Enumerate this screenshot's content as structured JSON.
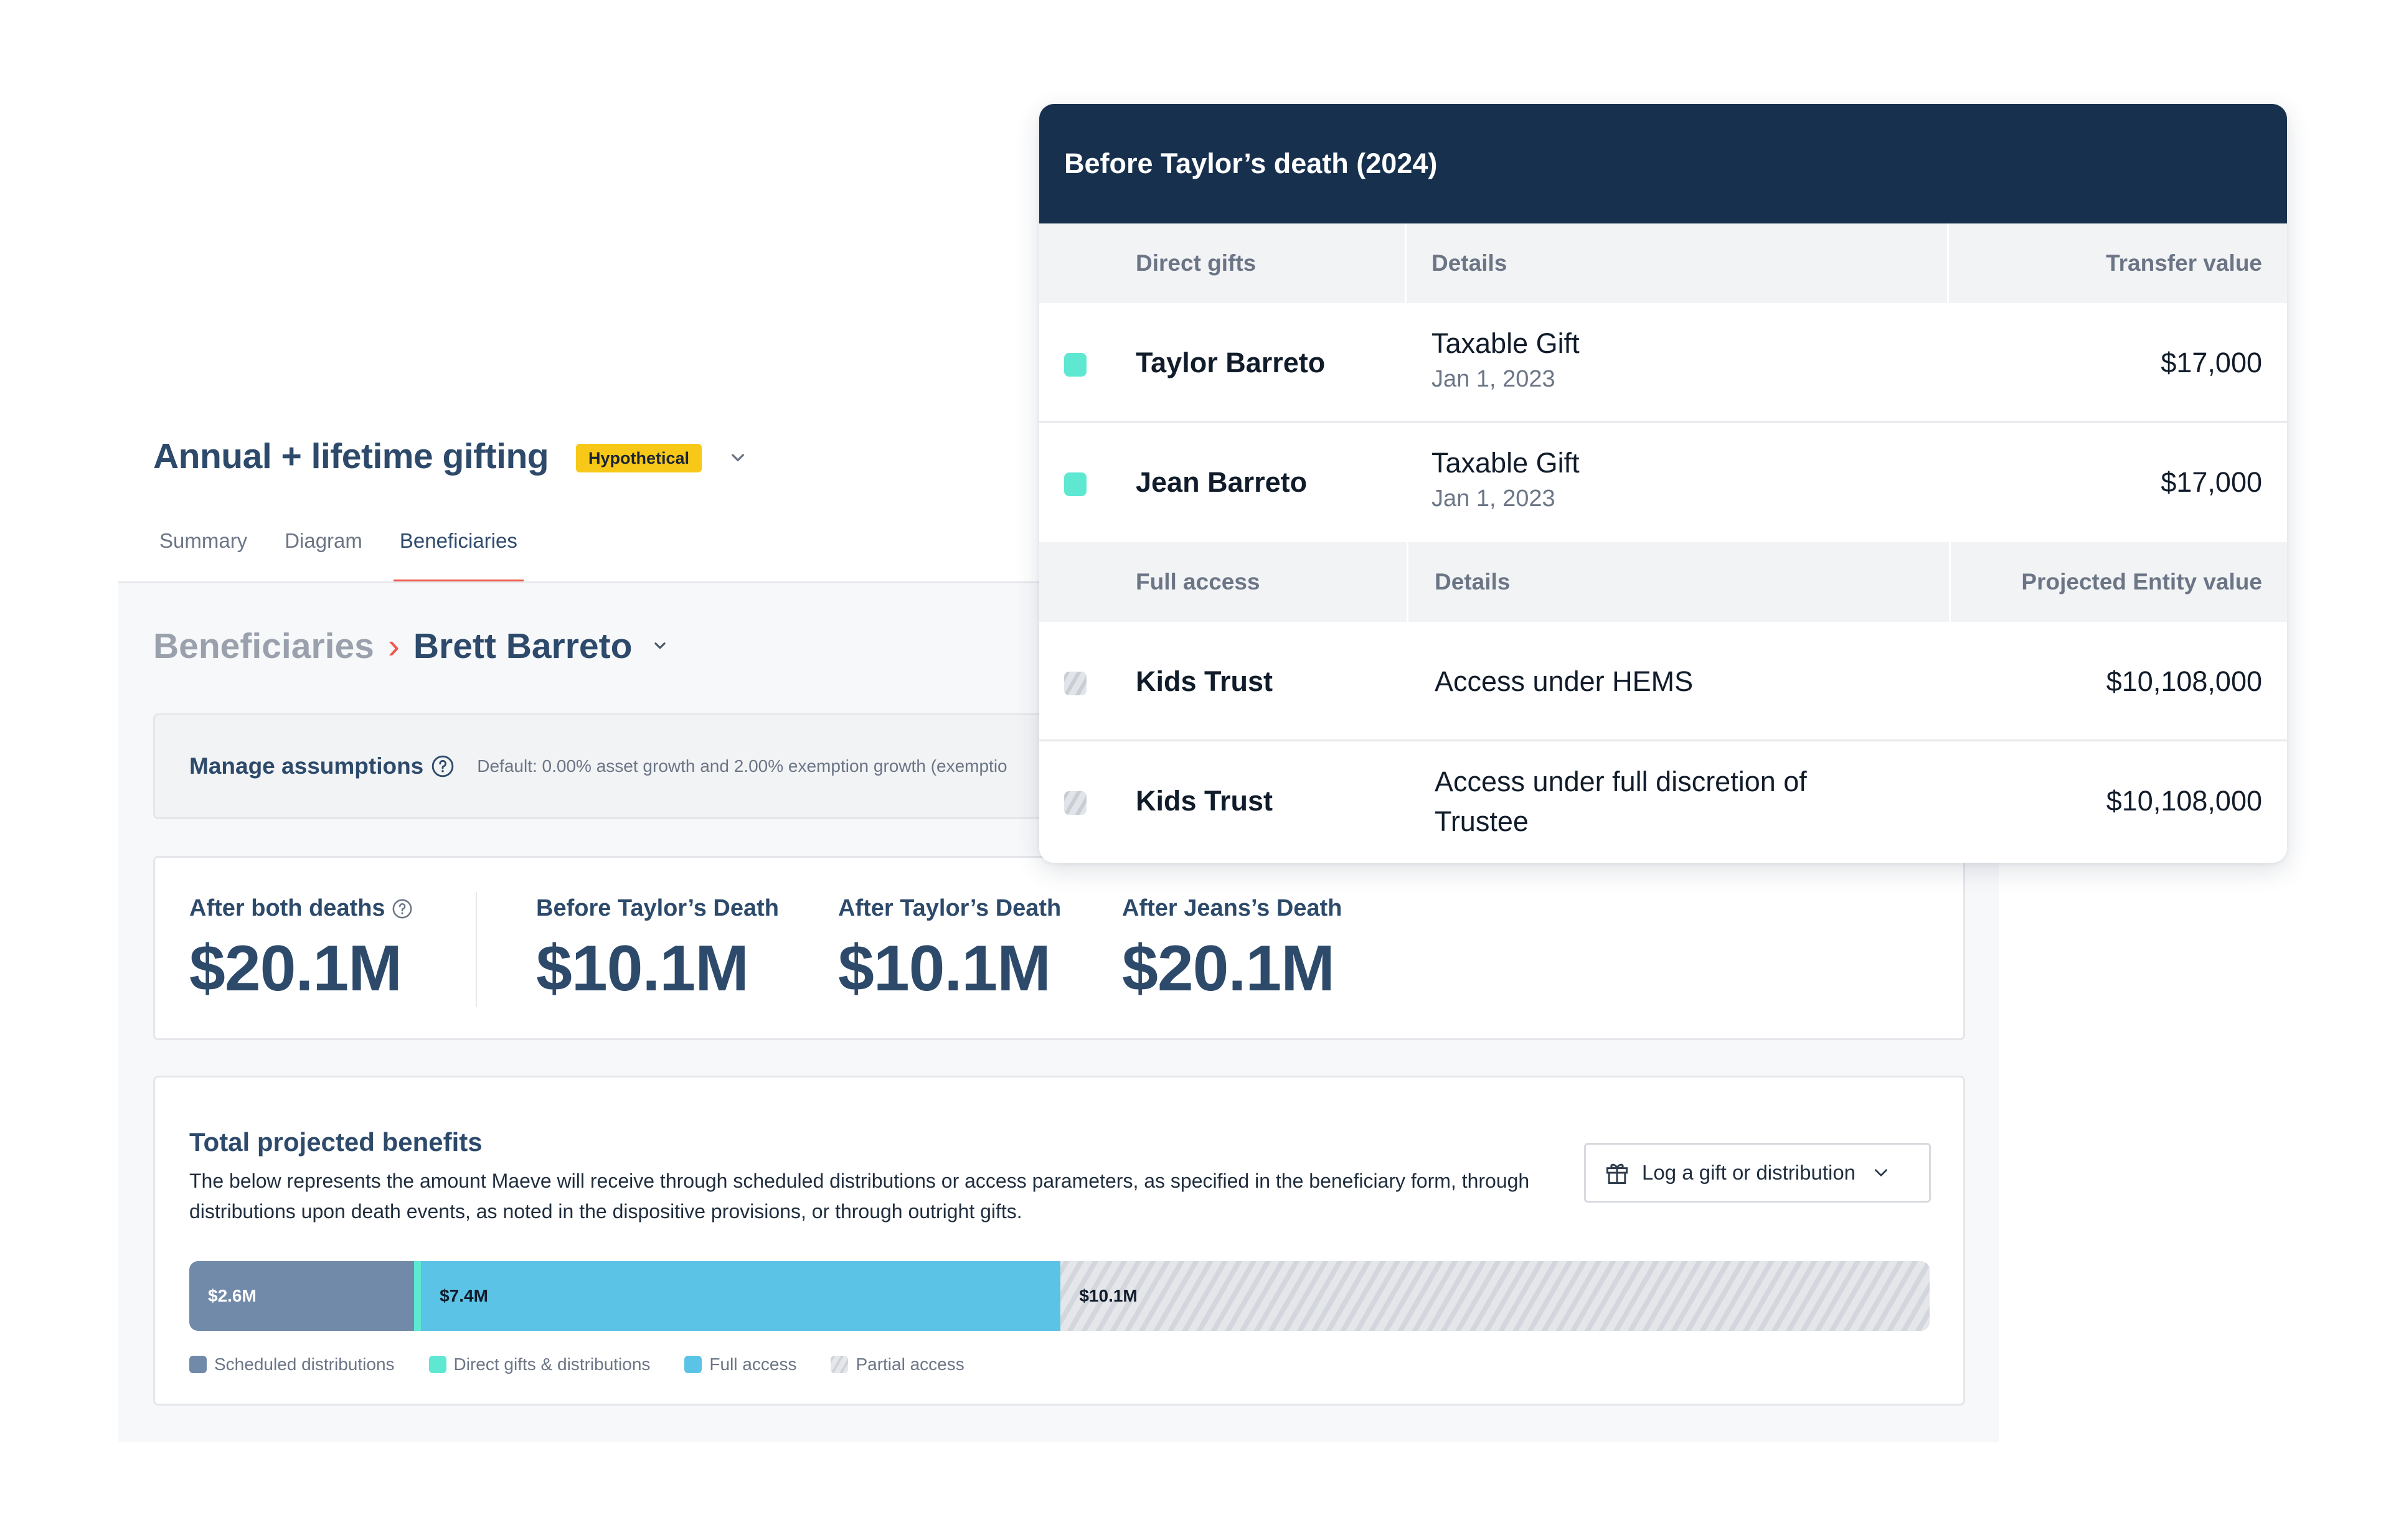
{
  "page": {
    "title": "Annual + lifetime gifting",
    "badge": "Hypothetical",
    "tabs": [
      {
        "label": "Summary",
        "active": false
      },
      {
        "label": "Diagram",
        "active": false
      },
      {
        "label": "Beneficiaries",
        "active": true
      }
    ]
  },
  "breadcrumb": {
    "parent": "Beneficiaries",
    "separator": "›",
    "current": "Brett Barreto"
  },
  "assumptions": {
    "label": "Manage assumptions",
    "description": "Default: 0.00% asset growth and 2.00% exemption growth (exemptio"
  },
  "stats": [
    {
      "label": "After both deaths",
      "value": "$20.1M",
      "has_help": true
    },
    {
      "label": "Before Taylor’s Death",
      "value": "$10.1M"
    },
    {
      "label": "After Taylor’s Death",
      "value": "$10.1M"
    },
    {
      "label": "After Jeans’s Death",
      "value": "$20.1M"
    }
  ],
  "benefits": {
    "title": "Total projected benefits",
    "description": "The below represents the amount Maeve will receive through scheduled distributions or access parameters, as specified in the beneficiary form, through distributions upon death events, as noted in the dispositive provisions, or through outright gifts.",
    "log_button": "Log a gift or distribution"
  },
  "chart_data": {
    "type": "bar",
    "orientation": "horizontal-stacked",
    "total_millions": 20.1,
    "segments": [
      {
        "name": "Scheduled distributions",
        "value_millions": 2.6,
        "label": "$2.6M",
        "color": "#728aaa"
      },
      {
        "name": "Direct gifts & distributions",
        "value_millions": 0.034,
        "label": "",
        "color": "#5ee8d2"
      },
      {
        "name": "Full access",
        "value_millions": 7.4,
        "label": "$7.4M",
        "color": "#5bc3e5"
      },
      {
        "name": "Partial access",
        "value_millions": 10.1,
        "label": "$10.1M",
        "color": "hatch"
      }
    ],
    "legend": [
      {
        "name": "Scheduled distributions",
        "color": "#728aaa"
      },
      {
        "name": "Direct gifts & distributions",
        "color": "#5ee8d2"
      },
      {
        "name": "Full access",
        "color": "#5bc3e5"
      },
      {
        "name": "Partial access",
        "color": "hatch"
      }
    ],
    "legend_position": "bottom-left"
  },
  "overlay": {
    "title": "Before Taylor’s death (2024)",
    "direct_gifts": {
      "headers": [
        "Direct gifts",
        "Details",
        "Transfer value"
      ],
      "rows": [
        {
          "name": "Taylor Barreto",
          "detail": "Taxable Gift",
          "date": "Jan 1, 2023",
          "value": "$17,000",
          "swatch": "#5ee8d2"
        },
        {
          "name": "Jean Barreto",
          "detail": "Taxable Gift",
          "date": "Jan 1, 2023",
          "value": "$17,000",
          "swatch": "#5ee8d2"
        }
      ]
    },
    "full_access": {
      "headers": [
        "Full access",
        "Details",
        "Projected Entity value"
      ],
      "rows": [
        {
          "name": "Kids Trust",
          "detail": "Access under HEMS",
          "value": "$10,108,000",
          "swatch": "hatch"
        },
        {
          "name": "Kids Trust",
          "detail": "Access under full discretion of Trustee",
          "value": "$10,108,000",
          "swatch": "hatch"
        }
      ]
    }
  }
}
